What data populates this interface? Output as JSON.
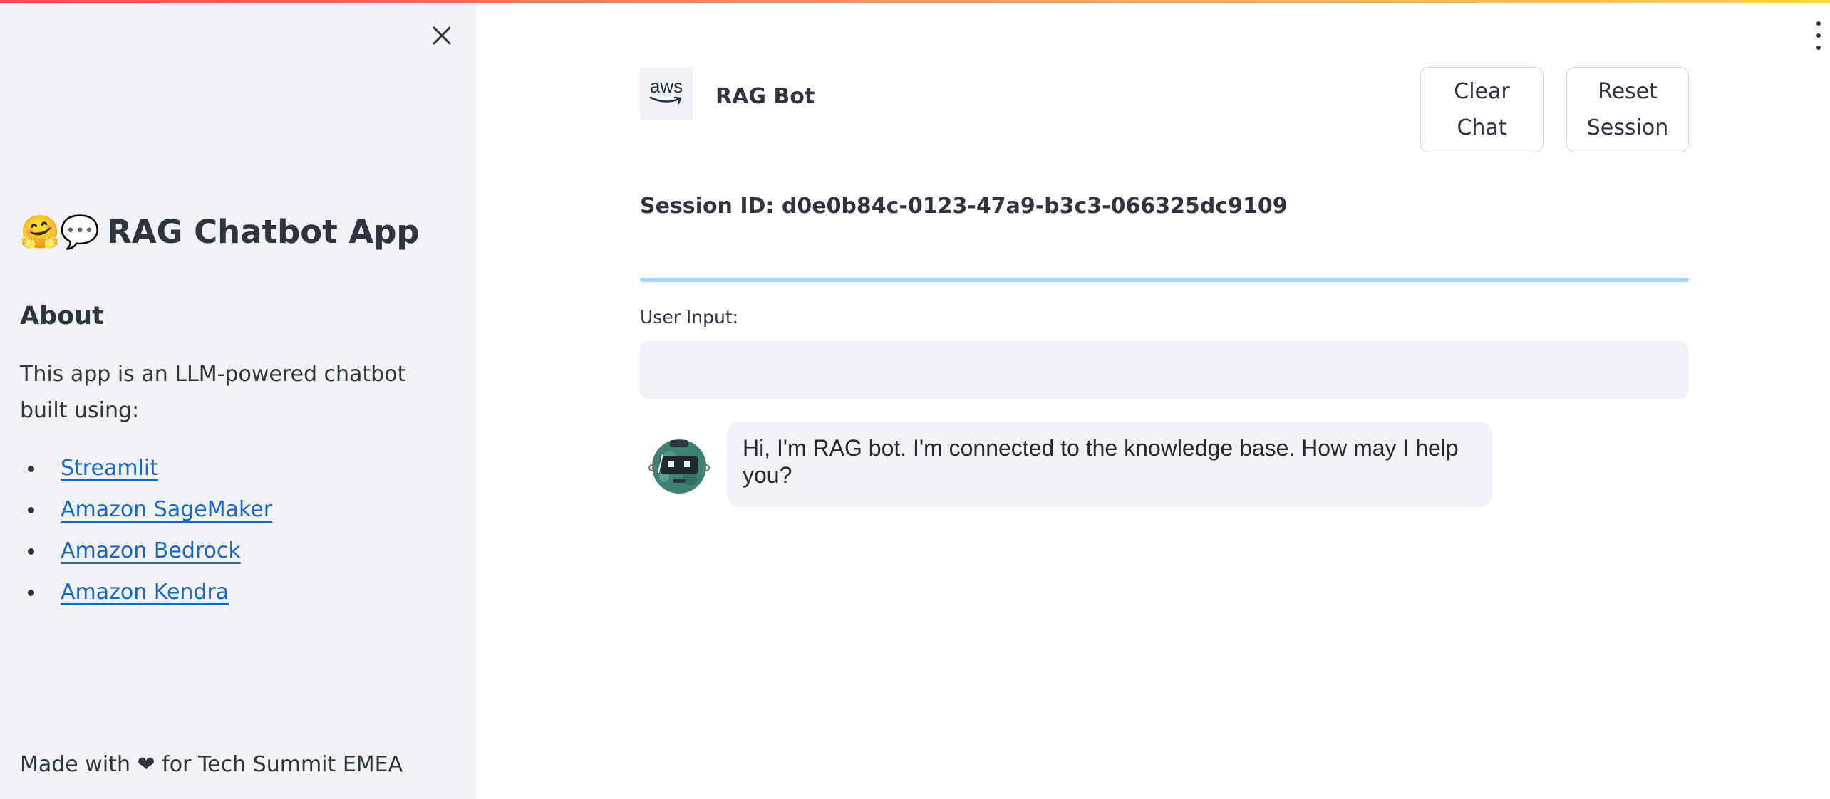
{
  "sidebar": {
    "close_icon": "close-icon",
    "title_emoji": "🤗💬",
    "title": "RAG Chatbot App",
    "about_heading": "About",
    "about_text": "This app is an LLM-powered chatbot built using:",
    "links": [
      {
        "label": "Streamlit"
      },
      {
        "label": "Amazon SageMaker"
      },
      {
        "label": "Amazon Bedrock"
      },
      {
        "label": "Amazon Kendra"
      }
    ],
    "footer": "Made with ❤ for Tech Summit EMEA"
  },
  "header": {
    "logo_text": "aws",
    "title": "RAG Bot",
    "clear_chat": [
      "Clear",
      "Chat"
    ],
    "reset_session": [
      "Reset",
      "Session"
    ],
    "menu_icon": "vertical-ellipsis-icon"
  },
  "session": {
    "text": "Session ID: d0e0b84c-0123-47a9-b3c3-066325dc9109"
  },
  "input": {
    "label": "User Input:",
    "value": "",
    "placeholder": ""
  },
  "chat": {
    "messages": [
      {
        "role": "assistant",
        "avatar": "robot-avatar",
        "text": "Hi, I'm RAG bot. I'm connected to the knowledge base. How may I help you?"
      }
    ]
  },
  "colors": {
    "sidebar_bg": "#f0f2f6",
    "link": "#1c66c6",
    "progress": "#a9d4f5",
    "text": "#31333f"
  }
}
